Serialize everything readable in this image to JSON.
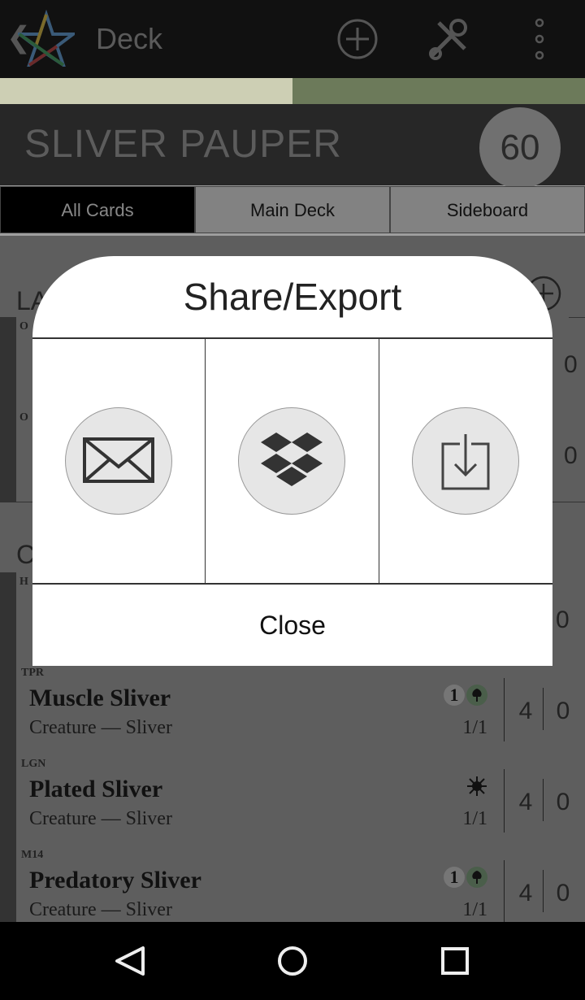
{
  "app_bar": {
    "title": "Deck",
    "back_icon": "chevron-left-icon",
    "logo": "pentagram-logo",
    "actions": [
      "add-circle-icon",
      "tools-icon",
      "overflow-menu-icon"
    ]
  },
  "progress": {
    "fraction": 0.5
  },
  "deck": {
    "name": "SLIVER PAUPER",
    "count": "60"
  },
  "tabs": [
    {
      "label": "All Cards",
      "selected": true
    },
    {
      "label": "Main Deck",
      "selected": false
    },
    {
      "label": "Sideboard",
      "selected": false
    }
  ],
  "list": {
    "section_lands_fragment": "LA",
    "section_creatures_fragment": "C",
    "partial_rows": [
      {
        "set_fragment": "O",
        "qty_side": "0"
      },
      {
        "set_fragment": "O",
        "qty_side": "0"
      },
      {
        "set_fragment": "H",
        "qty_side": "0"
      }
    ],
    "cards": [
      {
        "set": "TPR",
        "name": "Muscle Sliver",
        "type": "Creature — Sliver",
        "cost": [
          "1",
          "G"
        ],
        "pt": "1/1",
        "qty_main": "4",
        "qty_side": "0"
      },
      {
        "set": "LGN",
        "name": "Plated Sliver",
        "type": "Creature — Sliver",
        "cost": [
          "W"
        ],
        "pt": "1/1",
        "qty_main": "4",
        "qty_side": "0"
      },
      {
        "set": "M14",
        "name": "Predatory Sliver",
        "type": "Creature — Sliver",
        "cost": [
          "1",
          "G"
        ],
        "pt": "1/1",
        "qty_main": "4",
        "qty_side": "0"
      }
    ]
  },
  "modal": {
    "title": "Share/Export",
    "options": [
      {
        "icon": "email-icon"
      },
      {
        "icon": "dropbox-icon"
      },
      {
        "icon": "download-icon"
      }
    ],
    "close_label": "Close"
  },
  "nav": {
    "buttons": [
      "back-triangle-icon",
      "home-circle-icon",
      "recents-square-icon"
    ]
  },
  "colors": {
    "appbar": "#111111",
    "modal_bg": "#ffffff",
    "icon_circle": "#e6e6e6"
  }
}
